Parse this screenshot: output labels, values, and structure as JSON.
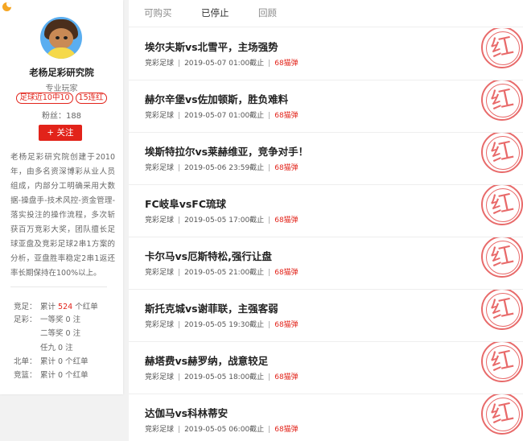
{
  "profile": {
    "name": "老杨足彩研究院",
    "title": "专业玩家",
    "badges": [
      "足球近10中10",
      "15连红"
    ],
    "fans": "粉丝：188",
    "follow_label": "+ 关注",
    "bio": "老杨足彩研究院创建于2010年，由多名资深博彩从业人员组成，内部分工明确采用大数据-操盘手-技术风控-资金管理-落实投注的操作流程，多次斩获百万竞彩大奖，团队擅长足球亚盘及竞彩足球2串1方案的分析，亚盘胜率稳定2串1返还率长期保持在100%以上。"
  },
  "stats": [
    {
      "label": "竞足：",
      "prefix": "累计 ",
      "value": "524",
      "suffix": " 个红单"
    },
    {
      "label": "足彩：",
      "prefix": "一等奖 0 注",
      "value": "",
      "suffix": ""
    },
    {
      "label": "",
      "prefix": "二等奖 0 注",
      "value": "",
      "suffix": ""
    },
    {
      "label": "",
      "prefix": "任九 0 注",
      "value": "",
      "suffix": ""
    },
    {
      "label": "北单：",
      "prefix": "累计 0 个红单",
      "value": "",
      "suffix": ""
    },
    {
      "label": "竞篮：",
      "prefix": "累计 0 个红单",
      "value": "",
      "suffix": ""
    }
  ],
  "tabs": [
    {
      "label": "可购买",
      "active": false
    },
    {
      "label": "已停止",
      "active": true
    },
    {
      "label": "回顾",
      "active": false
    }
  ],
  "stamp_char": "红",
  "articles": [
    {
      "title": "埃尔夫斯vs北雪平，主场强势",
      "category": "竞彩足球",
      "time": "2019-05-07 01:00截止",
      "price": "68猫弹"
    },
    {
      "title": "赫尔辛堡vs佐加顿斯，胜负难料",
      "category": "竞彩足球",
      "time": "2019-05-07 01:00截止",
      "price": "68猫弹"
    },
    {
      "title": "埃斯特拉尔vs莱赫维亚，竞争对手！",
      "category": "竞彩足球",
      "time": "2019-05-06 23:59截止",
      "price": "68猫弹"
    },
    {
      "title": "FC岐阜vsFC琉球",
      "category": "竞彩足球",
      "time": "2019-05-05 17:00截止",
      "price": "68猫弹"
    },
    {
      "title": "卡尔马vs厄斯特松,强行让盘",
      "category": "竞彩足球",
      "time": "2019-05-05 21:00截止",
      "price": "68猫弹"
    },
    {
      "title": "斯托克城vs谢菲联，主强客弱",
      "category": "竞彩足球",
      "time": "2019-05-05 19:30截止",
      "price": "68猫弹"
    },
    {
      "title": "赫塔费vs赫罗纳，战意较足",
      "category": "竞彩足球",
      "time": "2019-05-05 18:00截止",
      "price": "68猫弹"
    },
    {
      "title": "达伽马vs科林蒂安",
      "category": "竞彩足球",
      "time": "2019-05-05 06:00截止",
      "price": "68猫弹"
    }
  ],
  "colors": {
    "accent": "#e2231a",
    "stamp": "#e65a5a"
  }
}
